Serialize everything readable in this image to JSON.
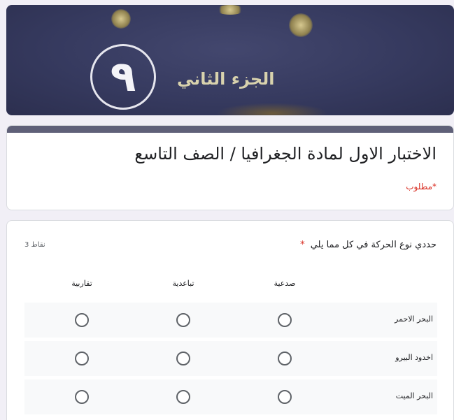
{
  "banner": {
    "number": "٩",
    "text": "الجزء الثاني"
  },
  "form": {
    "title": "الاختبار الاول لمادة الجغرافيا / الصف التاسع",
    "required_note": "*مطلوب"
  },
  "question": {
    "title": "حددي نوع الحركة في كل مما يلي",
    "required_star": "*",
    "points": "3 نقاط",
    "columns": [
      "صدعية",
      "تباعدية",
      "تقاربية"
    ],
    "rows": [
      {
        "label": "البحر الاحمر"
      },
      {
        "label": "اخدود البيرو"
      },
      {
        "label": "البحر الميت"
      }
    ]
  },
  "colors": {
    "accent": "#5f6078",
    "required": "#d93025",
    "background": "#f1eff6"
  }
}
